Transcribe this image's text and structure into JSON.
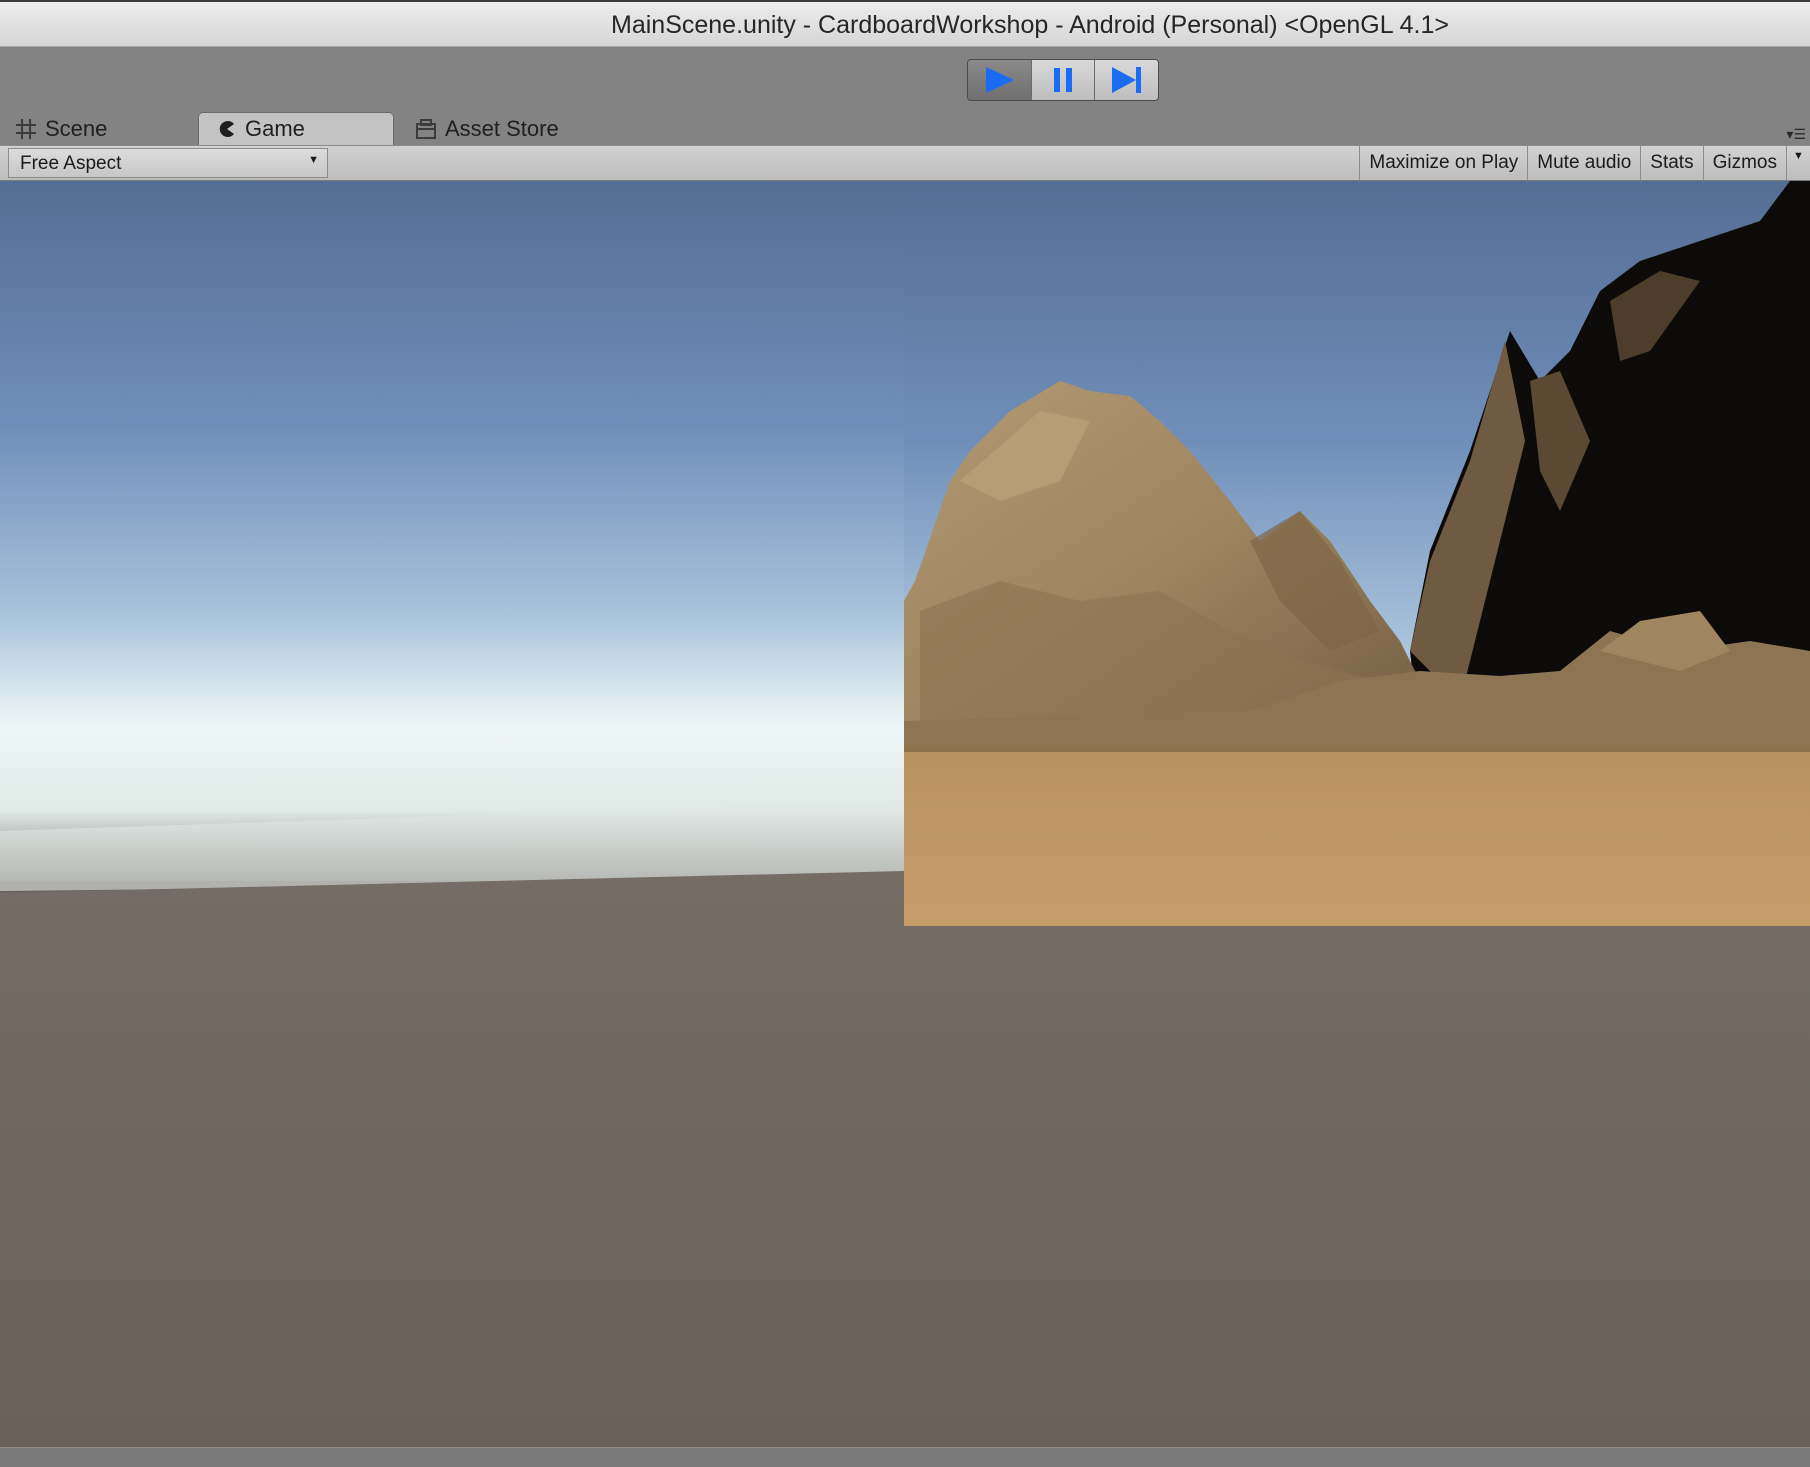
{
  "window": {
    "title": "MainScene.unity - CardboardWorkshop - Android (Personal) <OpenGL 4.1>"
  },
  "playback": {
    "play_icon": "play-icon",
    "pause_icon": "pause-icon",
    "step_icon": "step-icon",
    "play_active": true
  },
  "tabs": [
    {
      "label": "Scene",
      "icon": "grid-icon",
      "active": false
    },
    {
      "label": "Game",
      "icon": "pacman-icon",
      "active": true
    },
    {
      "label": "Asset Store",
      "icon": "store-icon",
      "active": false
    }
  ],
  "game_toolbar": {
    "aspect": "Free Aspect",
    "maximize_on_play": "Maximize on Play",
    "mute_audio": "Mute audio",
    "stats": "Stats",
    "gizmos": "Gizmos"
  },
  "colors": {
    "accent_blue": "#1a6cf5",
    "sky_top": "#566f95",
    "ground": "#6b625c",
    "sand": "#b08a5a"
  }
}
